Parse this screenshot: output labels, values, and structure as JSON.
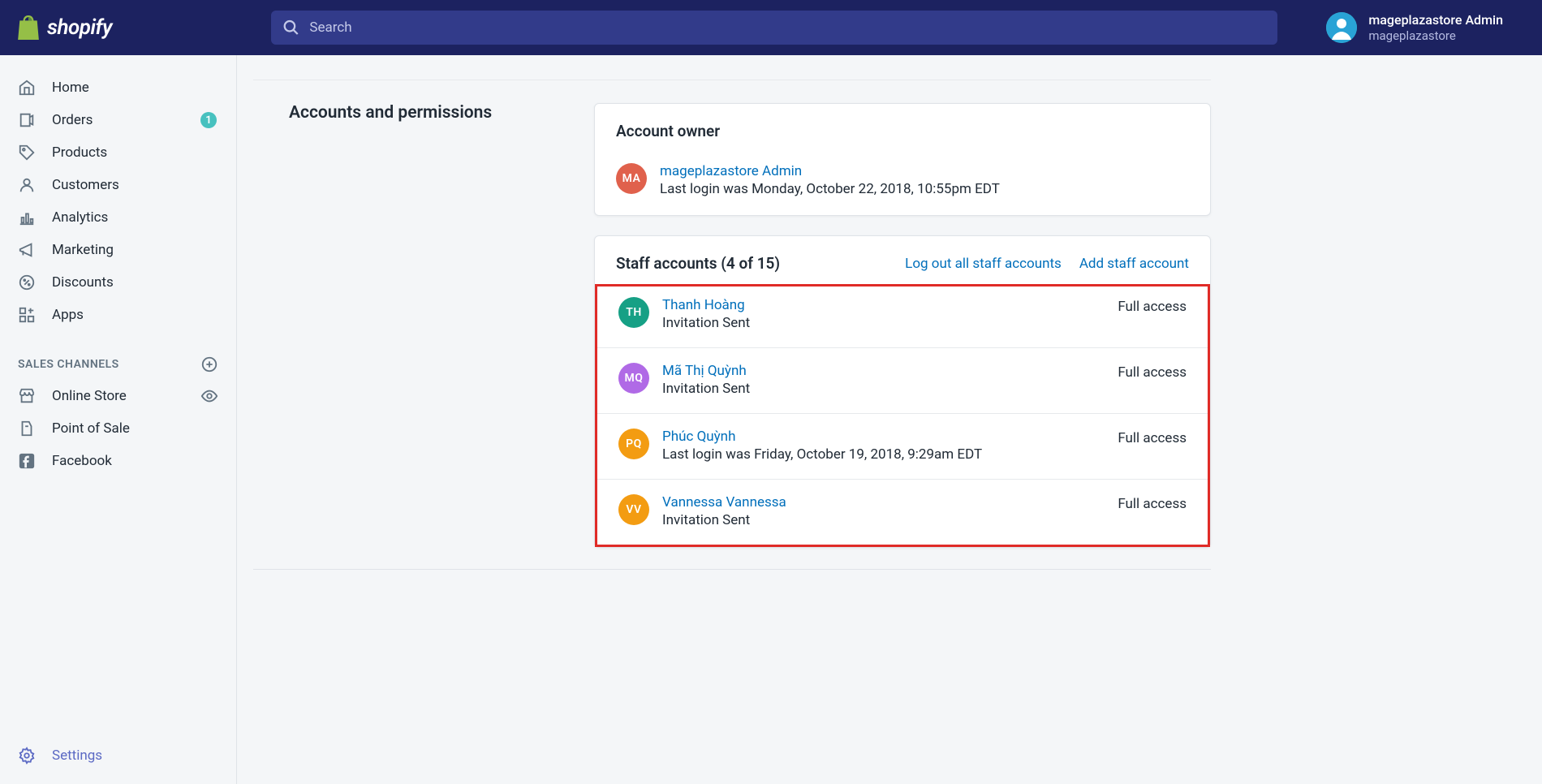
{
  "search": {
    "placeholder": "Search"
  },
  "user": {
    "name": "mageplazastore Admin",
    "store": "mageplazastore"
  },
  "sidebar": {
    "items": [
      {
        "label": "Home"
      },
      {
        "label": "Orders",
        "badge": "1"
      },
      {
        "label": "Products"
      },
      {
        "label": "Customers"
      },
      {
        "label": "Analytics"
      },
      {
        "label": "Marketing"
      },
      {
        "label": "Discounts"
      },
      {
        "label": "Apps"
      }
    ],
    "section_label": "SALES CHANNELS",
    "channels": [
      {
        "label": "Online Store"
      },
      {
        "label": "Point of Sale"
      },
      {
        "label": "Facebook"
      }
    ]
  },
  "settings_label": "Settings",
  "page": {
    "section_title": "Accounts and permissions",
    "owner": {
      "title": "Account owner",
      "avatar_text": "MA",
      "avatar_color": "#e0614c",
      "name": "mageplazastore Admin",
      "sub": "Last login was Monday, October 22, 2018, 10:55pm EDT"
    },
    "staff": {
      "title": "Staff accounts (4 of 15)",
      "logout_link": "Log out all staff accounts",
      "add_link": "Add staff account",
      "items": [
        {
          "avatar_text": "TH",
          "avatar_color": "#16a085",
          "name": "Thanh Hoàng",
          "sub": "Invitation Sent",
          "access": "Full access"
        },
        {
          "avatar_text": "MQ",
          "avatar_color": "#b06ae6",
          "name": "Mã Thị Quỳnh",
          "sub": "Invitation Sent",
          "access": "Full access"
        },
        {
          "avatar_text": "PQ",
          "avatar_color": "#f39c12",
          "name": "Phúc Quỳnh",
          "sub": "Last login was Friday, October 19, 2018, 9:29am EDT",
          "access": "Full access"
        },
        {
          "avatar_text": "VV",
          "avatar_color": "#f39c12",
          "name": "Vannessa Vannessa",
          "sub": "Invitation Sent",
          "access": "Full access"
        }
      ]
    }
  }
}
